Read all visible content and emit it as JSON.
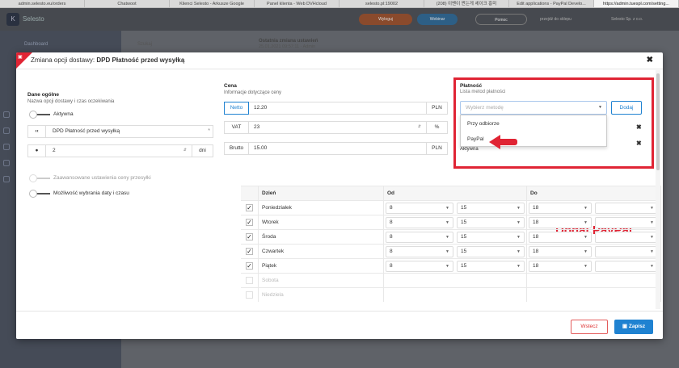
{
  "browser": {
    "tabs": [
      "admin.selesto.eu/orders",
      "Chatwoot",
      "Klienci Selesto - Arkusze Google",
      "Panel klienta - Web DVHcloud",
      "selesto.pl:19002",
      "(208) 이벤이 짠는게 셰이크 흥미",
      "Edit applications - PayPal Develo...",
      "https://admin.tuespl.com/setting..."
    ]
  },
  "app": {
    "brand": "Selesto",
    "side_item": "Dashboard",
    "search": "Szukaj",
    "header": "Ostatnia zmiana ustawień",
    "header_sub": "25.01.2021 09:57:11 · Admin",
    "top_user": "Selesto Sp. z o.o.",
    "btn_a": "Wyloguj",
    "btn_b": "Webinar",
    "btn_c": "Pomoc",
    "top_link": "przejdź do sklepu"
  },
  "modal": {
    "title_prefix": "Zmiana opcji dostawy:",
    "title_name": "DPD Płatność przed wysyłką",
    "general": {
      "title": "Dane ogólne",
      "subtitle": "Nazwa opcji dostawy i czas oczekiwania",
      "active_label": "Aktywna",
      "name_prefix": "‹‹",
      "name_value": "DPD Płatność przed wysyłką",
      "days_value": "2",
      "days_suffix": "dni",
      "advanced_label": "Zaawansowane ustawienia ceny przesyłki",
      "datetime_label": "Możliwość wybrania daty i czasu"
    },
    "price": {
      "title": "Cena",
      "subtitle": "Informacje dotyczące ceny",
      "netto_label": "Netto",
      "netto_value": "12.20",
      "netto_suffix": "PLN",
      "vat_label": "VAT",
      "vat_value": "23",
      "vat_suffix": "%",
      "brutto_label": "Brutto",
      "brutto_value": "15.00",
      "brutto_suffix": "PLN"
    },
    "payment": {
      "title": "Płatność",
      "subtitle": "Lista metod płatności",
      "select_placeholder": "Wybierz metodę",
      "add_label": "Dodaj",
      "options": [
        "Przy odbiorze",
        "PayPal"
      ],
      "status": "Aktywna"
    },
    "schedule": {
      "headers": [
        "Dzień",
        "Od",
        "Do"
      ],
      "rows": [
        {
          "day": "Poniedziałek",
          "from_h": "8",
          "from_m": "15",
          "to_h": "18",
          "checked": true
        },
        {
          "day": "Wtorek",
          "from_h": "8",
          "from_m": "15",
          "to_h": "18",
          "checked": true
        },
        {
          "day": "Środa",
          "from_h": "8",
          "from_m": "15",
          "to_h": "18",
          "checked": true
        },
        {
          "day": "Czwartek",
          "from_h": "8",
          "from_m": "15",
          "to_h": "18",
          "checked": true
        },
        {
          "day": "Piątek",
          "from_h": "8",
          "from_m": "15",
          "to_h": "18",
          "checked": true
        },
        {
          "day": "Sobota",
          "checked": false
        },
        {
          "day": "Niedziela",
          "checked": false
        }
      ]
    },
    "footer": {
      "back_label": "Wstecz",
      "save_label": "Zapisz"
    }
  },
  "annotation": {
    "text": "Dodaj PayPal",
    "color": "#e02434"
  }
}
